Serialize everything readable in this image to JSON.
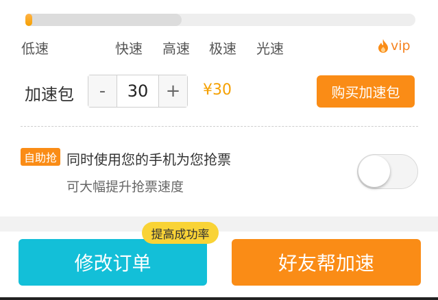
{
  "speed": {
    "levels": [
      "低速",
      "快速",
      "高速",
      "极速",
      "光速"
    ],
    "progress_fraction": 0.4,
    "vip_label": "vip",
    "vip_icon": "flame-icon"
  },
  "package": {
    "label": "加速包",
    "minus_label": "-",
    "plus_label": "+",
    "quantity": "30",
    "price": "¥30",
    "buy_label": "购买加速包"
  },
  "self_grab": {
    "badge": "自助抢",
    "line1": "同时使用您的手机为您抢票",
    "line2": "可大幅提升抢票速度",
    "toggle_on": false
  },
  "footer": {
    "tip": "提高成功率",
    "modify_label": "修改订单",
    "friend_label": "好友帮加速"
  },
  "colors": {
    "orange": "#fa8c16",
    "cyan": "#13bfd8",
    "yellow": "#f9d336",
    "price": "#f5a000"
  }
}
